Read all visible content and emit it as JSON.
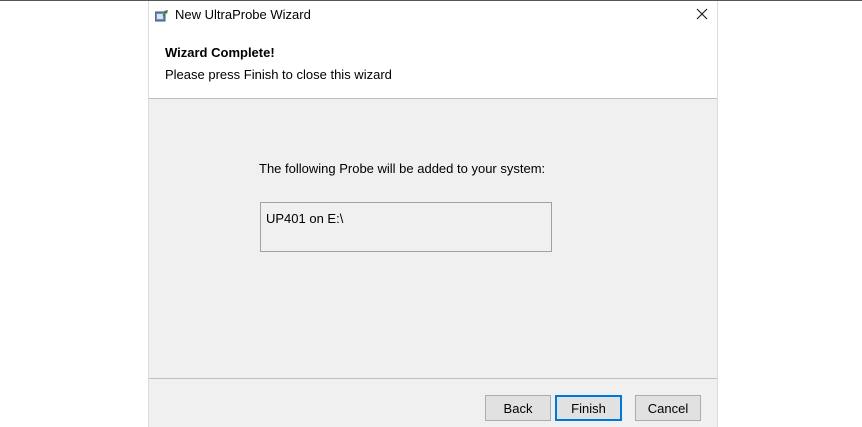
{
  "window": {
    "title": "New UltraProbe Wizard",
    "close_glyph": "✕"
  },
  "header": {
    "title": "Wizard Complete!",
    "subtitle": "Please press Finish to close this wizard"
  },
  "body": {
    "message": "The following Probe will be added to your system:",
    "probes": [
      "UP401 on E:\\"
    ]
  },
  "buttons": {
    "back": "Back",
    "finish": "Finish",
    "cancel": "Cancel"
  },
  "colors": {
    "panel_background": "#f0f0f0",
    "default_button_border": "#0078d7"
  },
  "icons": {
    "app": "wizard-app-icon",
    "close": "close-icon"
  }
}
